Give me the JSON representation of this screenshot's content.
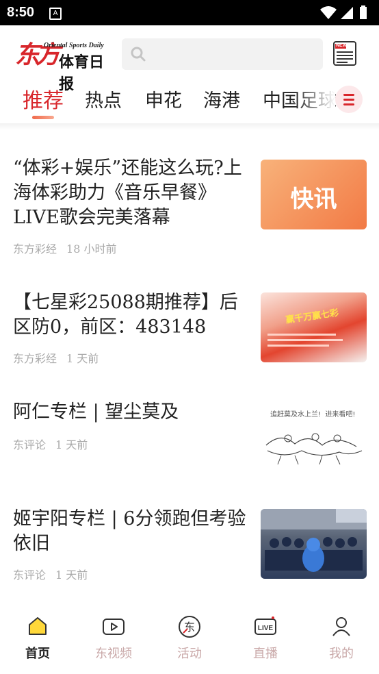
{
  "status_bar": {
    "time": "8:50",
    "notification": "A"
  },
  "header": {
    "logo_cn_brand": "东方",
    "logo_cn_name": "体育日报",
    "logo_en": "Oriental Sports Daily",
    "search_placeholder": "",
    "news_label": "NEWS"
  },
  "tabs": [
    {
      "label": "推荐",
      "active": true
    },
    {
      "label": "热点",
      "active": false
    },
    {
      "label": "申花",
      "active": false
    },
    {
      "label": "海港",
      "active": false
    },
    {
      "label": "中国足球",
      "active": false
    }
  ],
  "articles": [
    {
      "title": "“体彩+娱乐”还能这么玩?上海体彩助力《音乐早餐》LIVE歌会完美落幕",
      "source": "东方彩经",
      "time": "18 小时前",
      "thumb_text": "快讯"
    },
    {
      "title": "【七星彩25088期推荐】后区防0，前区：483148",
      "source": "东方彩经",
      "time": "1 天前",
      "thumb_text": "赢千万赢七彩"
    },
    {
      "title": "阿仁专栏 | 望尘莫及",
      "source": "东评论",
      "time": "1 天前",
      "thumb_text": "追赶莫及水上兰!  进来看吧!"
    },
    {
      "title": "姬宇阳专栏 | 6分领跑但考验依旧",
      "source": "东评论",
      "time": "1 天前",
      "thumb_text": ""
    }
  ],
  "bottom_nav": [
    {
      "label": "首页",
      "icon": "home-icon",
      "active": true
    },
    {
      "label": "东视频",
      "icon": "video-icon",
      "active": false
    },
    {
      "label": "活动",
      "icon": "event-icon",
      "active": false
    },
    {
      "label": "直播",
      "icon": "live-icon",
      "active": false
    },
    {
      "label": "我的",
      "icon": "profile-icon",
      "active": false
    }
  ],
  "colors": {
    "brand_red": "#d8262b",
    "orange": "#f07a3c",
    "inactive_nav": "#c9a8a8"
  }
}
